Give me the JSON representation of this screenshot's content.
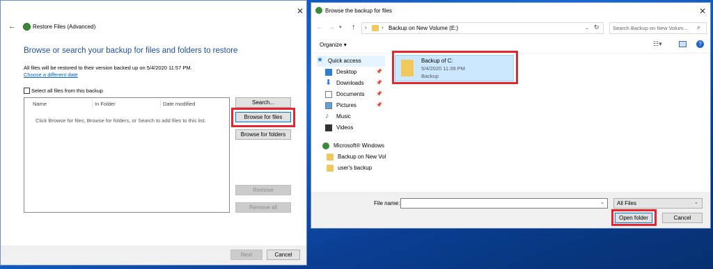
{
  "left_window": {
    "title": "Restore Files (Advanced)",
    "heading": "Browse or search your backup for files and folders to restore",
    "info_text": "All files will be restored to their version backed up on 5/4/2020 11:57 PM.",
    "choose_date_link": "Choose a different date",
    "select_all_label": "Select all files from this backup",
    "columns": [
      "Name",
      "In Folder",
      "Date modified"
    ],
    "empty_hint": "Click Browse for files, Browse for folders, or Search to add files to this list.",
    "buttons": {
      "search": "Search...",
      "browse_files": "Browse for files",
      "browse_folders": "Browse for folders",
      "remove": "Remove",
      "remove_all": "Remove all",
      "next": "Next",
      "cancel": "Cancel"
    }
  },
  "right_window": {
    "title": "Browse the backup for files",
    "breadcrumb": [
      "Backup on New Volume (E:)"
    ],
    "search_placeholder": "Search Backup on New Volum...",
    "organize_label": "Organize",
    "nav": {
      "quick_access": "Quick access",
      "items": [
        {
          "label": "Desktop",
          "icon": "desktop-icon",
          "pinned": true
        },
        {
          "label": "Downloads",
          "icon": "download-icon",
          "pinned": true
        },
        {
          "label": "Documents",
          "icon": "documents-icon",
          "pinned": true
        },
        {
          "label": "Pictures",
          "icon": "pictures-icon",
          "pinned": true
        },
        {
          "label": "Music",
          "icon": "music-icon",
          "pinned": false
        },
        {
          "label": "Videos",
          "icon": "videos-icon",
          "pinned": false
        }
      ],
      "backup_root": "Microsoft® Windows",
      "backup_children": [
        "Backup on New Vol",
        "user's backup"
      ]
    },
    "file_item": {
      "name": "Backup of C:",
      "date": "5/4/2020 11:39 PM",
      "type": "Backup"
    },
    "file_name_label": "File name:",
    "file_name_value": "",
    "filter": "All Files",
    "buttons": {
      "open_folder": "Open folder",
      "cancel": "Cancel"
    }
  },
  "colors": {
    "accent": "#0078d7",
    "highlight_box": "#e8242c",
    "selection": "#cce8ff",
    "heading": "#1e4e9b"
  }
}
